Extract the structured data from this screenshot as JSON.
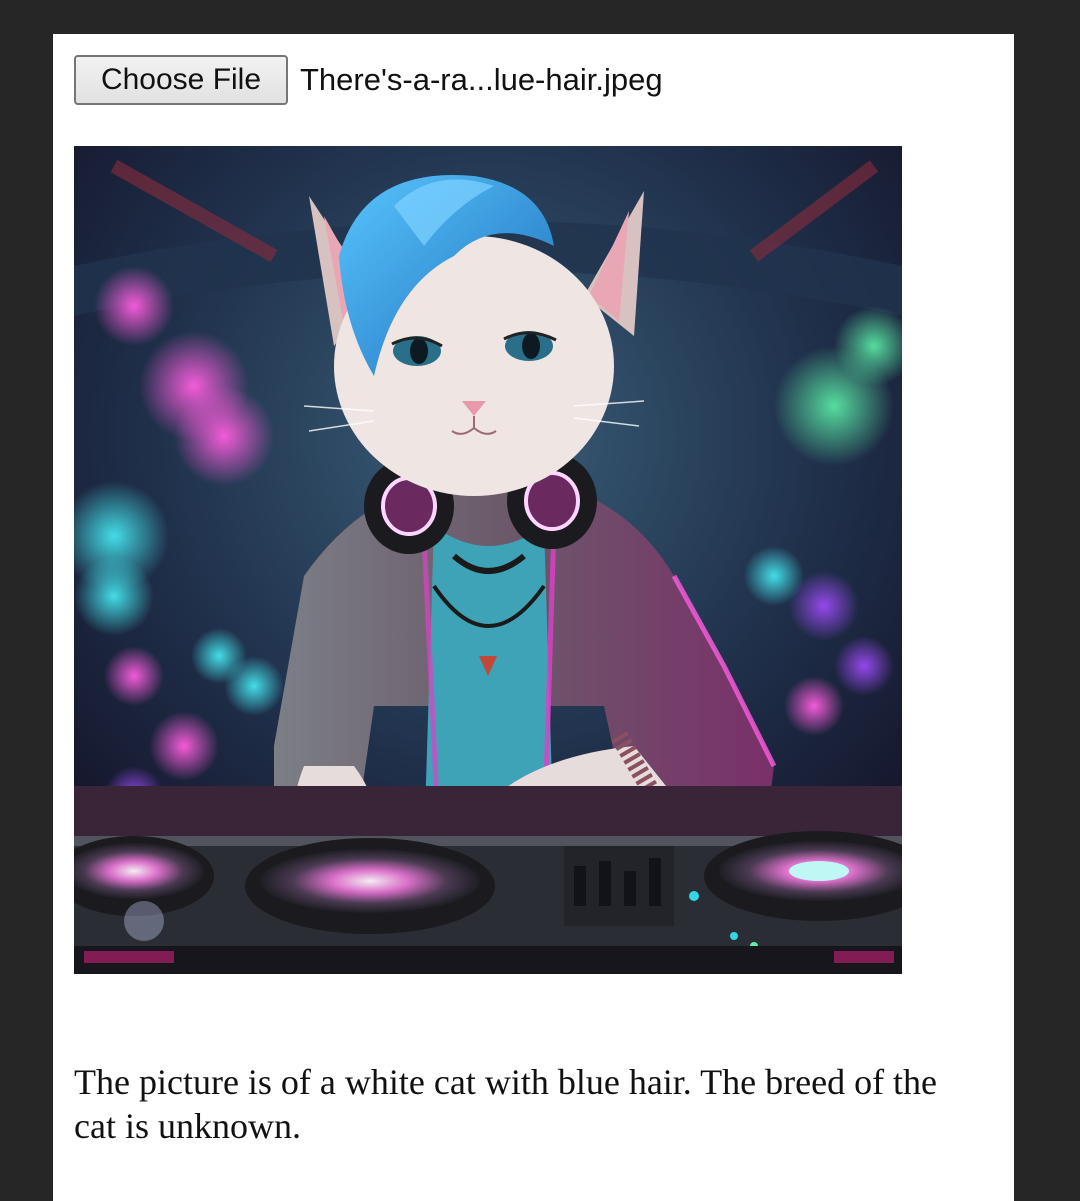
{
  "file_input": {
    "button_label": "Choose File",
    "file_name": "There's-a-ra...lue-hair.jpeg"
  },
  "preview_image": {
    "description_icon": "cat-dj-image",
    "colors": {
      "background_dark": "#1b2436",
      "fur": "#efe6e4",
      "hair": "#2f9fe0",
      "hoodie": "#6b3a5c",
      "shirt": "#3fa3b8",
      "neon_pink": "#e040c8",
      "neon_cyan": "#35d5e8",
      "deck": "#2a2d33"
    }
  },
  "result": {
    "text": "The picture is of a white cat with blue hair. The breed of the cat is unknown."
  }
}
